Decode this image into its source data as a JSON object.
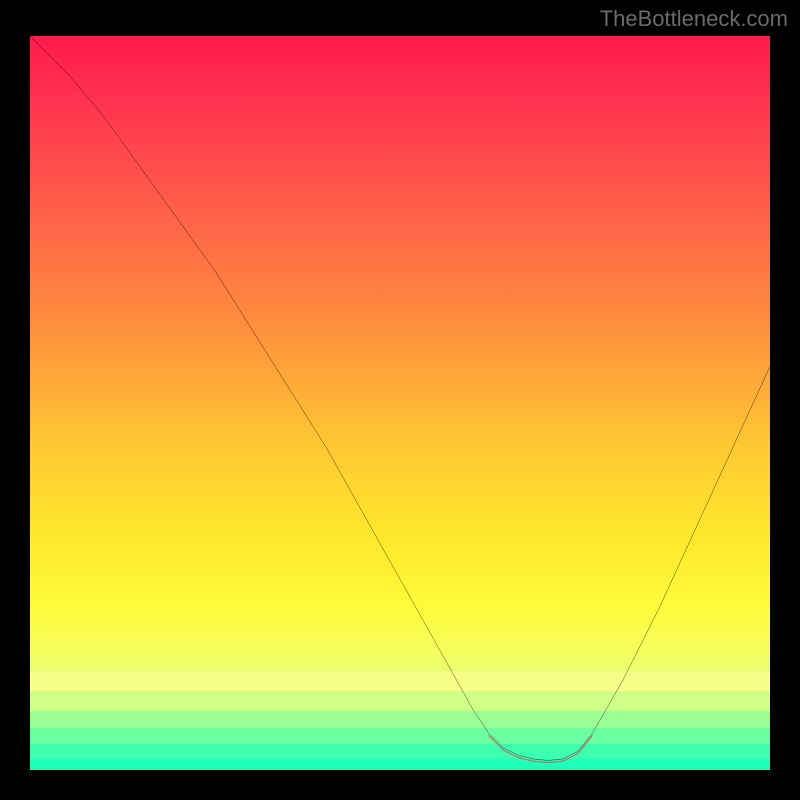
{
  "watermark": "TheBottleneck.com",
  "chart_data": {
    "type": "line",
    "title": "",
    "xlabel": "",
    "ylabel": "",
    "xlim": [
      0,
      100
    ],
    "ylim": [
      0,
      100
    ],
    "grid": false,
    "series": [
      {
        "name": "curve",
        "x": [
          0,
          5,
          10,
          15,
          20,
          25,
          30,
          35,
          40,
          45,
          50,
          55,
          60,
          62,
          64,
          66,
          68,
          70,
          72,
          74,
          76,
          80,
          85,
          90,
          95,
          100
        ],
        "y": [
          100,
          95,
          89,
          82,
          75,
          68,
          60,
          52,
          44,
          35,
          26,
          17,
          8,
          5,
          3,
          2,
          1.5,
          1.3,
          1.5,
          2.5,
          5,
          12,
          22,
          33,
          44,
          55
        ]
      }
    ],
    "annotations": [
      {
        "name": "valley-marker",
        "x_from": 62,
        "x_to": 76,
        "y": 3
      }
    ],
    "background_gradient": {
      "type": "vertical",
      "stops": [
        {
          "pos": 0,
          "color": "#ff1a4b"
        },
        {
          "pos": 22,
          "color": "#ff5a4a"
        },
        {
          "pos": 55,
          "color": "#ffc533"
        },
        {
          "pos": 78,
          "color": "#fffb3a"
        },
        {
          "pos": 94,
          "color": "#8aff90"
        },
        {
          "pos": 100,
          "color": "#1affb0"
        }
      ]
    },
    "bottom_bands": [
      {
        "color": "#f7ff87",
        "top_pct": 86.5,
        "height_pct": 2.8
      },
      {
        "color": "#d0ff88",
        "top_pct": 89.3,
        "height_pct": 2.6
      },
      {
        "color": "#9cff95",
        "top_pct": 91.9,
        "height_pct": 2.4
      },
      {
        "color": "#6cffa2",
        "top_pct": 94.3,
        "height_pct": 2.2
      },
      {
        "color": "#3effb0",
        "top_pct": 96.5,
        "height_pct": 2.0
      },
      {
        "color": "#1effb8",
        "top_pct": 98.5,
        "height_pct": 1.5
      }
    ]
  }
}
